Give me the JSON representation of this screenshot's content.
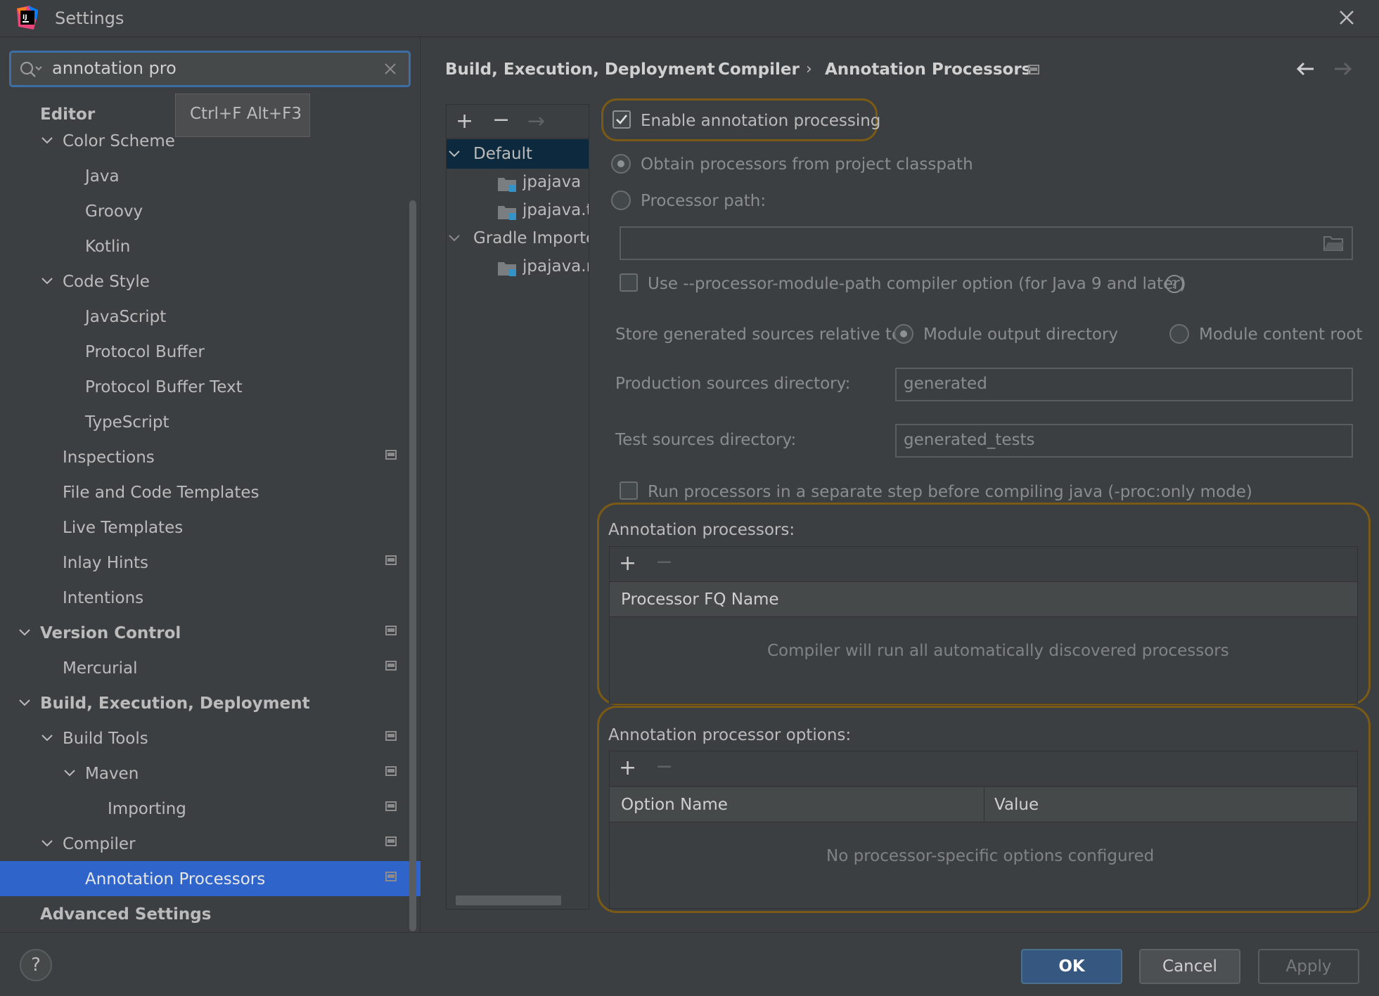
{
  "window": {
    "title": "Settings"
  },
  "search": {
    "value": "annotation pro",
    "tooltip": "Ctrl+F Alt+F3"
  },
  "sidebar": {
    "items": [
      {
        "label": "Editor"
      },
      {
        "label": "Color Scheme"
      },
      {
        "label": "Java"
      },
      {
        "label": "Groovy"
      },
      {
        "label": "Kotlin"
      },
      {
        "label": "Code Style"
      },
      {
        "label": "JavaScript"
      },
      {
        "label": "Protocol Buffer"
      },
      {
        "label": "Protocol Buffer Text"
      },
      {
        "label": "TypeScript"
      },
      {
        "label": "Inspections"
      },
      {
        "label": "File and Code Templates"
      },
      {
        "label": "Live Templates"
      },
      {
        "label": "Inlay Hints"
      },
      {
        "label": "Intentions"
      },
      {
        "label": "Version Control"
      },
      {
        "label": "Mercurial"
      },
      {
        "label": "Build, Execution, Deployment"
      },
      {
        "label": "Build Tools"
      },
      {
        "label": "Maven"
      },
      {
        "label": "Importing"
      },
      {
        "label": "Compiler"
      },
      {
        "label": "Annotation Processors"
      },
      {
        "label": "Advanced Settings"
      }
    ]
  },
  "breadcrumb": {
    "items": [
      "Build, Execution, Deployment",
      "Compiler",
      "Annotation Processors"
    ],
    "separator": "›"
  },
  "profiles": {
    "items": [
      {
        "label": "Default"
      },
      {
        "label": "jpajava"
      },
      {
        "label": "jpajava.te"
      },
      {
        "label": "Gradle Importe"
      },
      {
        "label": "jpajava.m"
      }
    ]
  },
  "settings": {
    "enable_processing": "Enable annotation processing",
    "obtain_classpath": "Obtain processors from project classpath",
    "processor_path": "Processor path:",
    "module_path_option": "Use --processor-module-path compiler option (for Java 9 and later)",
    "store_relative": "Store generated sources relative to:",
    "module_output": "Module output directory",
    "module_content": "Module content root",
    "production_label": "Production sources directory:",
    "production_value": "generated",
    "test_label": "Test sources directory:",
    "test_value": "generated_tests",
    "run_separate": "Run processors in a separate step before compiling java (-proc:only mode)"
  },
  "processors_table": {
    "title": "Annotation processors:",
    "column": "Processor FQ Name",
    "empty": "Compiler will run all automatically discovered processors"
  },
  "options_table": {
    "title": "Annotation processor options:",
    "columns": [
      "Option Name",
      "Value"
    ],
    "empty": "No processor-specific options configured"
  },
  "buttons": {
    "help": "?",
    "ok": "OK",
    "cancel": "Cancel",
    "apply": "Apply"
  },
  "colors": {
    "accent": "#2f65ca",
    "highlight": "#7a5a15",
    "ok_button": "#365880"
  }
}
